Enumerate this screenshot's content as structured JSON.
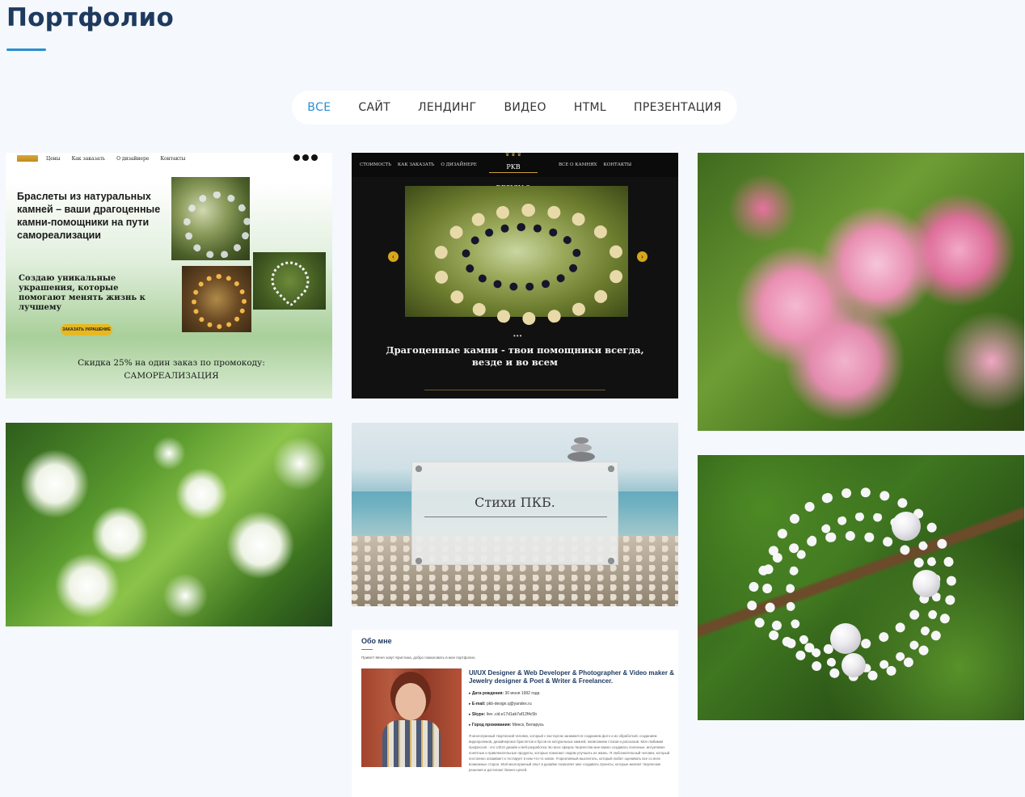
{
  "page": {
    "title": "Портфолио"
  },
  "filters": {
    "active_index": 0,
    "items": [
      "ВСЕ",
      "САЙТ",
      "ЛЕНДИНГ",
      "ВИДЕО",
      "HTML",
      "ПРЕЗЕНТАЦИЯ"
    ],
    "accent_color": "#2a8fd0"
  },
  "portfolio": {
    "card_bracelets": {
      "nav": [
        "Цены",
        "Как заказать",
        "О дизайнере",
        "Контакты"
      ],
      "heading": "Браслеты из натуральных камней – ваши драгоценные камни-помощники на пути самореализации",
      "subheading": "Создаю уникальные украшения, которые помогают менять жизнь к лучшему",
      "cta": "ЗАКАЗАТЬ УКРАШЕНИЕ",
      "promo_line1": "Скидка 25% на один заказ по промокоду:",
      "promo_line2": "САМОРЕАЛИЗАЦИЯ"
    },
    "card_dark": {
      "nav_left": [
        "СТОИМОСТЬ",
        "КАК ЗАКАЗАТЬ",
        "О ДИЗАЙНЕРЕ"
      ],
      "brand": "PKB DESIGN.Q",
      "nav_right": [
        "ВСЕ О КАМНЯХ",
        "КОНТАКТЫ"
      ],
      "caption": "Драгоценные камни - твои помощники всегда, везде и во всем"
    },
    "card_poems": {
      "title": "Стихи ПКБ."
    },
    "card_about": {
      "title": "Обо мне",
      "intro": "Привет! Меня зовут Кристина, добро пожаловать в мое портфолио.",
      "role": "UI/UX Designer & Web Developer & Photographer & Video maker & Jewelry designer & Poet & Writer & Freelancer.",
      "facts": [
        {
          "label": "Дата рождения:",
          "value": "30 июня 1992 года"
        },
        {
          "label": "E-mail:",
          "value": "pkb-design.q@yandex.ru"
        },
        {
          "label": "Skype:",
          "value": "live:.cid.e17d1ab7af12f4c5b"
        },
        {
          "label": "Город проживания:",
          "value": "Минск, Беларусь"
        }
      ],
      "description": "Я многогранный творческий человек, который с восторгом занимается созданием фото и их обработкой, созданием видеороликов, дизайнерских браслетов и бусов из натуральных камней, написанием стихов и рассказов. Моя любимая профессия - это UI/UX дизайн и веб-разработка. Во всех сферах творчества мне важно создавать полезные, интуитивно понятные и привлекательные продукты, которые помогают людям улучшать их жизнь. Я любознательный человек, который постоянно осваивает и тестирует в нем что-то новое. Я креативный мыслитель, который любит оценивать все со всех возможных сторон. Мой многогранный опыт в дизайне позволяет мне создавать проекты, которые меняют творческие решения и достигают бизнес-целей."
    }
  }
}
